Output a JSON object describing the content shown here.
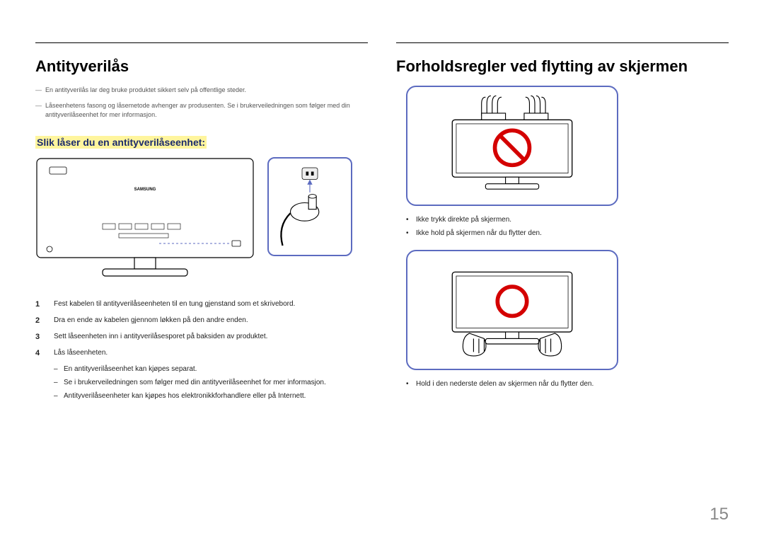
{
  "left": {
    "title": "Antityverilås",
    "note1": "En antityverilås lar deg bruke produktet sikkert selv på offentlige steder.",
    "note2": "Låseenhetens fasong og låsemetode avhenger av produsenten. Se i brukerveiledningen som følger med din antityverilåseenhet for mer informasjon.",
    "subheading": "Slik låser du en antityverilåseenhet:",
    "brand": "SAMSUNG",
    "steps": [
      "Fest kabelen til antityverilåseenheten til en tung gjenstand som et skrivebord.",
      "Dra en ende av kabelen gjennom løkken på den andre enden.",
      "Sett låseenheten inn i antityverilåsesporet på baksiden av produktet.",
      "Lås låseenheten."
    ],
    "notes_after": [
      "En antityverilåseenhet kan kjøpes separat.",
      "Se i brukerveiledningen som følger med din antityverilåseenhet for mer informasjon.",
      "Antityverilåseenheter kan kjøpes hos elektronikkforhandlere eller på Internett."
    ]
  },
  "right": {
    "title": "Forholdsregler ved flytting av skjermen",
    "bullets1": [
      "Ikke trykk direkte på skjermen.",
      "Ikke hold på skjermen når du flytter den."
    ],
    "bullets2": [
      "Hold i den nederste delen av skjermen når du flytter den."
    ]
  },
  "page_number": "15"
}
